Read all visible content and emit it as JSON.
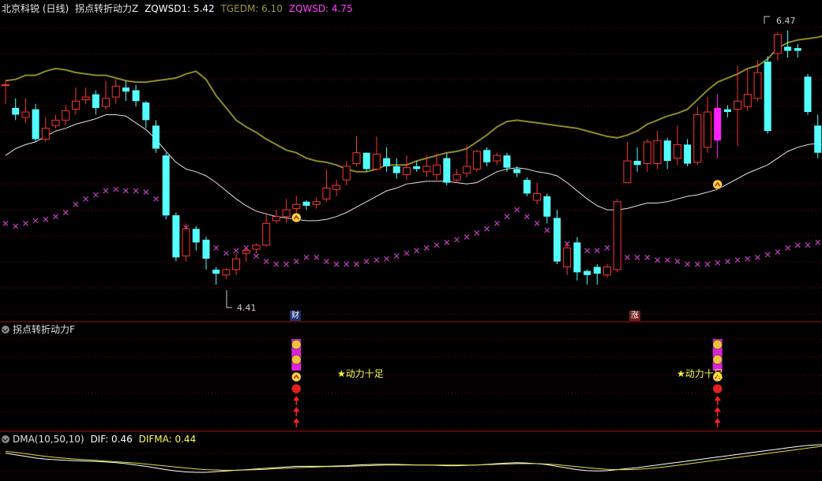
{
  "main_panel": {
    "title": "北京科锐 (日线)",
    "indicator_name": "拐点转折动力Z",
    "zqwsd1_label": "ZQWSD1: 5.42",
    "tgedm_label": "TGEDM: 6.10",
    "zqwsd_label": "ZQWSD: 4.75",
    "high_label": "6.47",
    "low_label": "4.41",
    "event_cai": "财",
    "event_zhang": "涨"
  },
  "sub_panel": {
    "title": "拐点转折动力F",
    "signal_text": "★动力十足"
  },
  "dma_panel": {
    "title": "DMA(10,50,10)",
    "dif_label": "DIF: 0.46",
    "difma_label": "DIFMA: 0.44"
  },
  "colors": {
    "up": "#ff3232",
    "down": "#54ffff",
    "cross": "#c040c0",
    "ma_olive": "#8c8c20",
    "ma_white": "#e0e0e0",
    "grid": "#8b0000",
    "divider": "#a01010",
    "magenta_label": "#ff40ff",
    "yellow_label": "#ffff40",
    "signal_icon": "#ffd040"
  },
  "chart_data": {
    "type": "candlestick",
    "candles": [
      [
        6.02,
        6.02,
        6.05,
        5.88
      ],
      [
        5.85,
        5.8,
        5.92,
        5.76
      ],
      [
        5.78,
        5.82,
        5.92,
        5.74
      ],
      [
        5.84,
        5.62,
        5.88,
        5.6
      ],
      [
        5.62,
        5.7,
        5.78,
        5.6
      ],
      [
        5.72,
        5.76,
        5.8,
        5.7
      ],
      [
        5.76,
        5.83,
        5.87,
        5.72
      ],
      [
        5.84,
        5.9,
        6.0,
        5.8
      ],
      [
        5.91,
        5.93,
        6.0,
        5.88
      ],
      [
        5.95,
        5.85,
        5.98,
        5.8
      ],
      [
        5.86,
        5.92,
        6.05,
        5.84
      ],
      [
        5.93,
        6.01,
        6.06,
        5.88
      ],
      [
        6.0,
        5.97,
        6.05,
        5.9
      ],
      [
        5.98,
        5.9,
        6.02,
        5.86
      ],
      [
        5.89,
        5.76,
        5.9,
        5.7
      ],
      [
        5.72,
        5.55,
        5.76,
        5.52
      ],
      [
        5.5,
        5.06,
        5.52,
        5.03
      ],
      [
        5.06,
        4.75,
        5.08,
        4.72
      ],
      [
        4.76,
        4.96,
        5.0,
        4.72
      ],
      [
        4.96,
        4.86,
        4.98,
        4.8
      ],
      [
        4.88,
        4.74,
        4.9,
        4.66
      ],
      [
        4.66,
        4.63,
        4.68,
        4.55
      ],
      [
        4.62,
        4.66,
        4.67,
        4.59
      ],
      [
        4.66,
        4.74,
        4.78,
        4.62
      ],
      [
        4.78,
        4.8,
        4.82,
        4.72
      ],
      [
        4.81,
        4.84,
        4.85,
        4.78
      ],
      [
        4.84,
        5.0,
        5.08,
        4.83
      ],
      [
        5.02,
        5.05,
        5.1,
        5.0
      ],
      [
        5.05,
        5.1,
        5.18,
        5.0
      ],
      [
        5.11,
        5.14,
        5.2,
        5.06
      ],
      [
        5.16,
        5.13,
        5.17,
        5.1
      ],
      [
        5.14,
        5.16,
        5.19,
        5.11
      ],
      [
        5.18,
        5.26,
        5.4,
        5.16
      ],
      [
        5.25,
        5.28,
        5.32,
        5.2
      ],
      [
        5.32,
        5.42,
        5.46,
        5.28
      ],
      [
        5.44,
        5.52,
        5.64,
        5.42
      ],
      [
        5.52,
        5.4,
        5.52,
        5.38
      ],
      [
        5.4,
        5.51,
        5.64,
        5.39
      ],
      [
        5.48,
        5.42,
        5.56,
        5.38
      ],
      [
        5.42,
        5.37,
        5.48,
        5.33
      ],
      [
        5.36,
        5.41,
        5.5,
        5.32
      ],
      [
        5.42,
        5.4,
        5.46,
        5.38
      ],
      [
        5.38,
        5.42,
        5.5,
        5.34
      ],
      [
        5.36,
        5.43,
        5.52,
        5.32
      ],
      [
        5.48,
        5.3,
        5.52,
        5.28
      ],
      [
        5.32,
        5.36,
        5.4,
        5.3
      ],
      [
        5.37,
        5.42,
        5.58,
        5.34
      ],
      [
        5.4,
        5.53,
        5.54,
        5.38
      ],
      [
        5.54,
        5.45,
        5.56,
        5.42
      ],
      [
        5.46,
        5.5,
        5.52,
        5.43
      ],
      [
        5.5,
        5.41,
        5.52,
        5.38
      ],
      [
        5.4,
        5.37,
        5.42,
        5.34
      ],
      [
        5.32,
        5.22,
        5.34,
        5.2
      ],
      [
        5.17,
        5.22,
        5.3,
        5.14
      ],
      [
        5.2,
        5.05,
        5.22,
        5.0
      ],
      [
        5.04,
        4.72,
        5.1,
        4.7
      ],
      [
        4.68,
        4.82,
        4.86,
        4.62
      ],
      [
        4.86,
        4.64,
        4.9,
        4.58
      ],
      [
        4.65,
        4.62,
        4.66,
        4.55
      ],
      [
        4.68,
        4.63,
        4.7,
        4.55
      ],
      [
        4.62,
        4.68,
        4.7,
        4.6
      ],
      [
        4.66,
        5.16,
        5.18,
        4.64
      ],
      [
        5.3,
        5.46,
        5.6,
        5.3
      ],
      [
        5.46,
        5.43,
        5.56,
        5.38
      ],
      [
        5.44,
        5.6,
        5.62,
        5.38
      ],
      [
        5.44,
        5.61,
        5.68,
        5.4
      ],
      [
        5.61,
        5.46,
        5.63,
        5.4
      ],
      [
        5.48,
        5.58,
        5.72,
        5.43
      ],
      [
        5.58,
        5.44,
        5.62,
        5.42
      ],
      [
        5.45,
        5.8,
        5.86,
        5.43
      ],
      [
        5.56,
        5.82,
        5.93,
        5.52
      ],
      [
        5.61,
        5.85,
        5.95,
        5.48
      ],
      [
        5.84,
        5.82,
        5.87,
        5.78
      ],
      [
        5.84,
        5.9,
        6.16,
        5.57
      ],
      [
        5.86,
        5.95,
        6.14,
        5.83
      ],
      [
        5.92,
        6.11,
        6.2,
        5.9
      ],
      [
        6.19,
        5.68,
        6.23,
        5.66
      ],
      [
        6.25,
        6.39,
        6.41,
        6.2
      ],
      [
        6.3,
        6.27,
        6.42,
        6.22
      ],
      [
        6.29,
        6.27,
        6.32,
        6.22
      ],
      [
        6.08,
        5.82,
        6.1,
        5.8
      ],
      [
        5.72,
        5.52,
        5.8,
        5.48
      ],
      [
        5.47,
        5.28,
        5.5,
        5.22
      ]
    ],
    "ma_olive": [
      6.05,
      6.06,
      6.09,
      6.09,
      6.12,
      6.14,
      6.13,
      6.11,
      6.1,
      6.09,
      6.09,
      6.07,
      6.05,
      6.04,
      6.04,
      6.05,
      6.06,
      6.07,
      6.1,
      6.12,
      6.06,
      5.94,
      5.85,
      5.76,
      5.71,
      5.67,
      5.62,
      5.58,
      5.54,
      5.52,
      5.48,
      5.46,
      5.45,
      5.43,
      5.4,
      5.38,
      5.38,
      5.4,
      5.43,
      5.43,
      5.43,
      5.46,
      5.48,
      5.5,
      5.52,
      5.53,
      5.55,
      5.6,
      5.65,
      5.71,
      5.75,
      5.76,
      5.75,
      5.74,
      5.73,
      5.72,
      5.71,
      5.7,
      5.68,
      5.66,
      5.64,
      5.63,
      5.65,
      5.68,
      5.73,
      5.76,
      5.79,
      5.81,
      5.84,
      5.91,
      5.98,
      6.04,
      6.07,
      6.1,
      6.14,
      6.16,
      6.21,
      6.29,
      6.33,
      6.35,
      6.36,
      6.37,
      6.39
    ],
    "ma_white": [
      5.5,
      5.55,
      5.58,
      5.6,
      5.64,
      5.68,
      5.7,
      5.73,
      5.75,
      5.77,
      5.8,
      5.8,
      5.79,
      5.74,
      5.69,
      5.62,
      5.53,
      5.45,
      5.4,
      5.38,
      5.35,
      5.3,
      5.24,
      5.18,
      5.13,
      5.09,
      5.07,
      5.05,
      5.04,
      5.03,
      5.02,
      5.02,
      5.03,
      5.05,
      5.08,
      5.12,
      5.16,
      5.2,
      5.24,
      5.26,
      5.29,
      5.3,
      5.31,
      5.31,
      5.31,
      5.3,
      5.29,
      5.3,
      5.34,
      5.38,
      5.4,
      5.41,
      5.4,
      5.38,
      5.37,
      5.35,
      5.3,
      5.24,
      5.18,
      5.13,
      5.1,
      5.1,
      5.11,
      5.13,
      5.15,
      5.15,
      5.16,
      5.18,
      5.2,
      5.21,
      5.23,
      5.25,
      5.29,
      5.33,
      5.37,
      5.4,
      5.43,
      5.48,
      5.53,
      5.56,
      5.58,
      5.59,
      5.57
    ],
    "crosses": [
      5.0,
      4.98,
      5.0,
      5.02,
      5.03,
      5.05,
      5.08,
      5.14,
      5.18,
      5.21,
      5.24,
      5.25,
      5.24,
      5.24,
      5.23,
      5.18,
      5.07,
      5.02,
      4.97,
      4.92,
      4.86,
      4.82,
      4.78,
      4.8,
      4.82,
      4.76,
      4.72,
      4.7,
      4.7,
      4.72,
      4.75,
      4.75,
      4.72,
      4.7,
      4.7,
      4.7,
      4.72,
      4.73,
      4.74,
      4.76,
      4.78,
      4.8,
      4.82,
      4.84,
      4.86,
      4.88,
      4.9,
      4.93,
      4.96,
      5.0,
      5.05,
      5.1,
      5.05,
      5.0,
      4.95,
      4.9,
      4.85,
      4.8,
      4.8,
      4.8,
      4.82,
      4.76,
      4.75,
      4.75,
      4.75,
      4.73,
      4.73,
      4.72,
      4.7,
      4.7,
      4.7,
      4.71,
      4.72,
      4.73,
      4.74,
      4.75,
      4.77,
      4.79,
      4.82,
      4.84,
      4.84,
      4.86,
      4.9
    ],
    "markers": {
      "candle_highlight_index": 71,
      "signal_index_a": 29,
      "signal_index_b": 71,
      "high_index": 77,
      "low_index": 21
    },
    "dma_dif": [
      0.2,
      0.15,
      0.1,
      0.05,
      0.02,
      0.0,
      -0.02,
      -0.03,
      -0.04,
      -0.05,
      -0.07,
      -0.09,
      -0.12,
      -0.16,
      -0.2,
      -0.25,
      -0.3,
      -0.34,
      -0.37,
      -0.38,
      -0.38,
      -0.36,
      -0.34,
      -0.32,
      -0.3,
      -0.28,
      -0.26,
      -0.24,
      -0.22,
      -0.2,
      -0.2,
      -0.2,
      -0.2,
      -0.19,
      -0.18,
      -0.16,
      -0.15,
      -0.14,
      -0.14,
      -0.14,
      -0.15,
      -0.16,
      -0.16,
      -0.17,
      -0.18,
      -0.18,
      -0.17,
      -0.16,
      -0.14,
      -0.12,
      -0.1,
      -0.09,
      -0.1,
      -0.12,
      -0.15,
      -0.2,
      -0.25,
      -0.3,
      -0.33,
      -0.34,
      -0.33,
      -0.3,
      -0.27,
      -0.24,
      -0.2,
      -0.16,
      -0.12,
      -0.08,
      -0.04,
      0.0,
      0.04,
      0.08,
      0.12,
      0.16,
      0.2,
      0.24,
      0.28,
      0.32,
      0.36,
      0.4,
      0.43,
      0.45,
      0.46
    ],
    "dma_difma": [
      0.25,
      0.22,
      0.18,
      0.14,
      0.1,
      0.07,
      0.04,
      0.02,
      0.0,
      -0.02,
      -0.04,
      -0.06,
      -0.08,
      -0.1,
      -0.13,
      -0.16,
      -0.19,
      -0.22,
      -0.25,
      -0.28,
      -0.3,
      -0.31,
      -0.32,
      -0.32,
      -0.31,
      -0.3,
      -0.29,
      -0.27,
      -0.26,
      -0.24,
      -0.23,
      -0.22,
      -0.21,
      -0.21,
      -0.2,
      -0.19,
      -0.18,
      -0.17,
      -0.16,
      -0.16,
      -0.16,
      -0.16,
      -0.16,
      -0.16,
      -0.16,
      -0.16,
      -0.16,
      -0.16,
      -0.15,
      -0.14,
      -0.13,
      -0.12,
      -0.12,
      -0.12,
      -0.13,
      -0.15,
      -0.18,
      -0.21,
      -0.24,
      -0.27,
      -0.29,
      -0.3,
      -0.3,
      -0.29,
      -0.27,
      -0.24,
      -0.21,
      -0.17,
      -0.13,
      -0.09,
      -0.05,
      -0.01,
      0.03,
      0.07,
      0.11,
      0.15,
      0.19,
      0.23,
      0.27,
      0.31,
      0.35,
      0.39,
      0.44
    ]
  }
}
